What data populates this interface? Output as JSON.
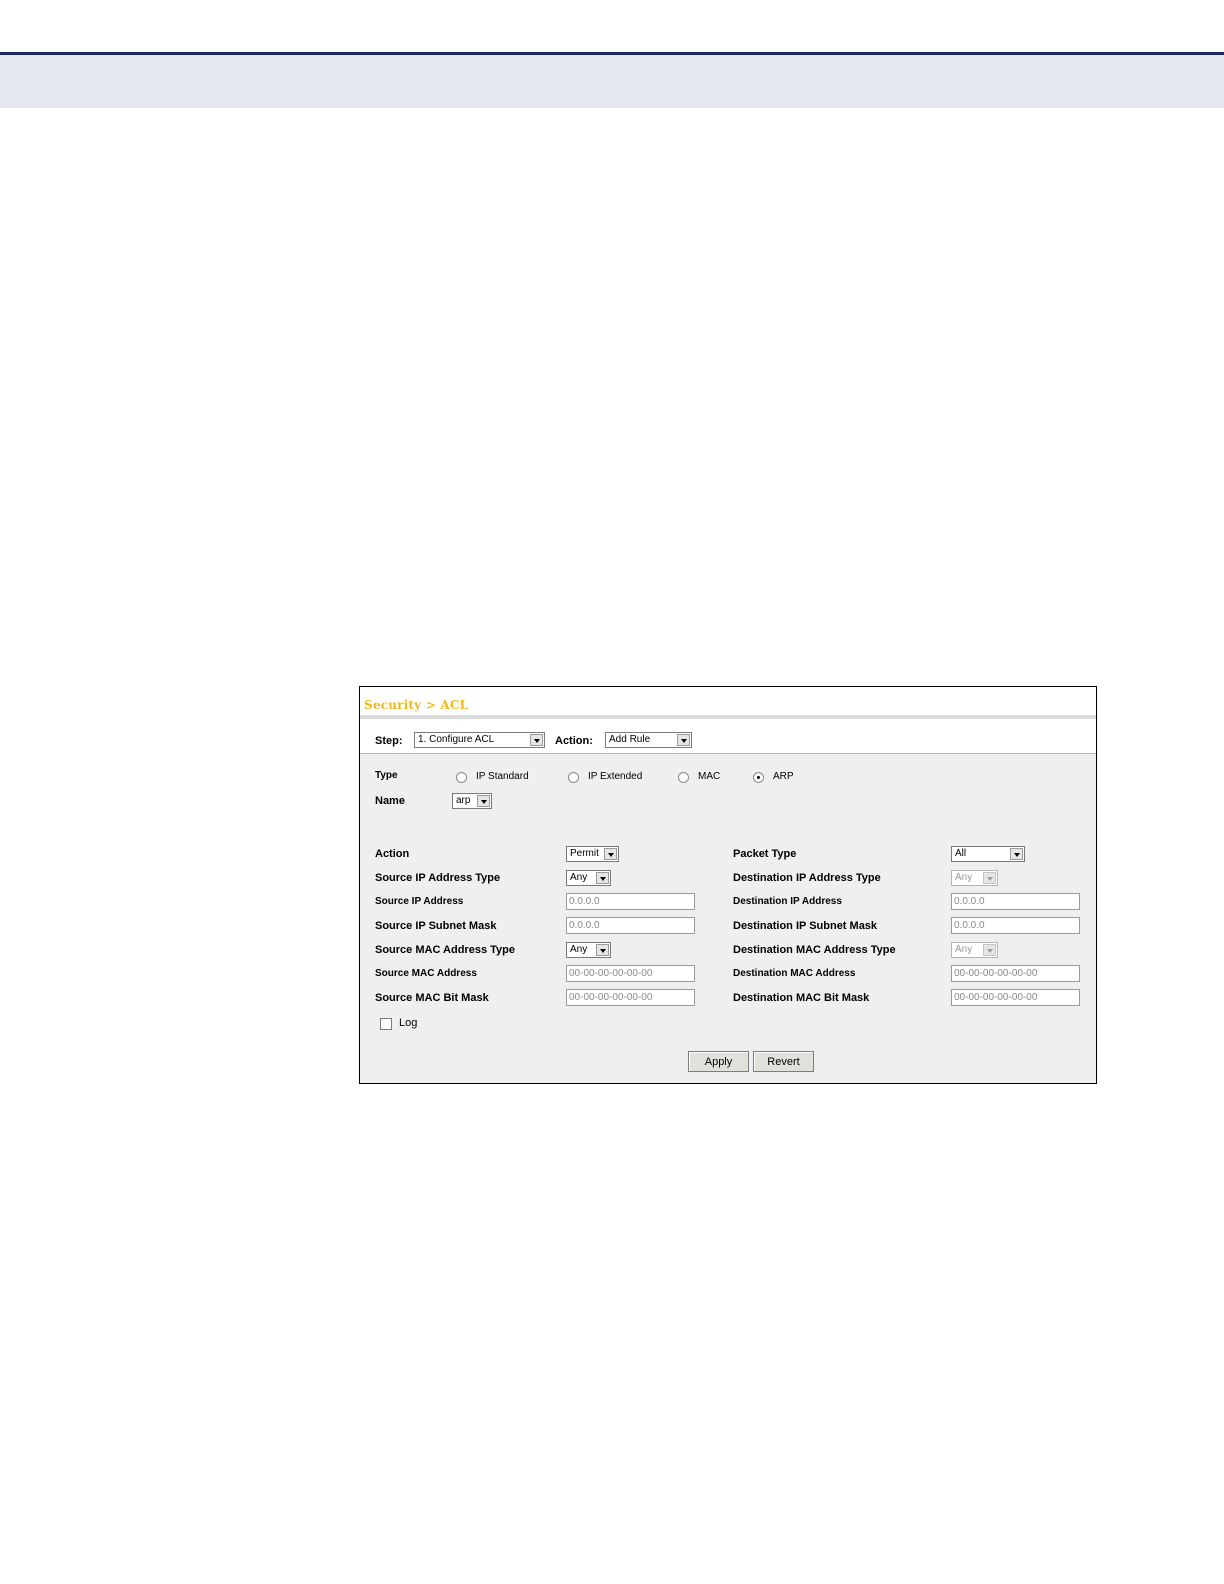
{
  "page": {
    "header_band_color": "#e4e7ee",
    "rule_color": "#1a2a5c"
  },
  "panel": {
    "breadcrumb": "Security > ACL",
    "step_label": "Step:",
    "step_value": "1. Configure ACL",
    "action_label": "Action:",
    "action_value": "Add Rule",
    "type_label": "Type",
    "type_options": [
      "IP Standard",
      "IP Extended",
      "MAC",
      "ARP"
    ],
    "type_selected": "ARP",
    "name_label": "Name",
    "name_value": "arp",
    "left_fields": [
      {
        "label": "Action",
        "value": "Permit",
        "kind": "select"
      },
      {
        "label": "Source IP Address Type",
        "value": "Any",
        "kind": "select"
      },
      {
        "label": "Source IP Address",
        "value": "0.0.0.0",
        "kind": "text"
      },
      {
        "label": "Source IP Subnet Mask",
        "value": "0.0.0.0",
        "kind": "text"
      },
      {
        "label": "Source MAC Address Type",
        "value": "Any",
        "kind": "select"
      },
      {
        "label": "Source MAC Address",
        "value": "00-00-00-00-00-00",
        "kind": "text"
      },
      {
        "label": "Source MAC Bit Mask",
        "value": "00-00-00-00-00-00",
        "kind": "text"
      }
    ],
    "right_fields": [
      {
        "label": "Packet Type",
        "value": "All",
        "kind": "select"
      },
      {
        "label": "Destination IP Address Type",
        "value": "Any",
        "kind": "select-disabled"
      },
      {
        "label": "Destination IP Address",
        "value": "0.0.0.0",
        "kind": "text"
      },
      {
        "label": "Destination IP Subnet Mask",
        "value": "0.0.0.0",
        "kind": "text"
      },
      {
        "label": "Destination MAC Address Type",
        "value": "Any",
        "kind": "select-disabled"
      },
      {
        "label": "Destination MAC Address",
        "value": "00-00-00-00-00-00",
        "kind": "text"
      },
      {
        "label": "Destination MAC Bit Mask",
        "value": "00-00-00-00-00-00",
        "kind": "text"
      }
    ],
    "log_label": "Log",
    "log_checked": false,
    "apply_label": "Apply",
    "revert_label": "Revert"
  }
}
